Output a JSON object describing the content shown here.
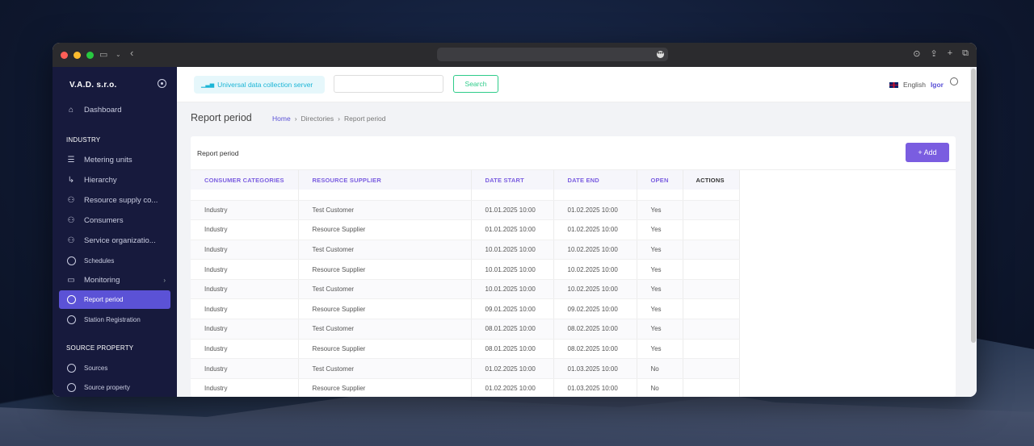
{
  "colors": {
    "accent": "#5b52d6",
    "add_button": "#7a5de0",
    "search_green": "#2ecc8a",
    "server_cyan": "#1bb5d6",
    "sidebar_bg": "#171a3d"
  },
  "sidebar": {
    "brand": "V.A.D. s.r.o.",
    "dashboard": "Dashboard",
    "section_industry": "INDUSTRY",
    "items": [
      {
        "label": "Metering units",
        "icon": "server-icon"
      },
      {
        "label": "Hierarchy",
        "icon": "arrow-turn-icon"
      },
      {
        "label": "Resource supply co...",
        "icon": "users-icon"
      },
      {
        "label": "Consumers",
        "icon": "users-icon"
      },
      {
        "label": "Service organizatio...",
        "icon": "users-icon"
      },
      {
        "label": "Schedules",
        "icon": "circle-icon"
      },
      {
        "label": "Monitoring",
        "icon": "monitor-icon"
      },
      {
        "label": "Report period",
        "icon": "circle-icon"
      },
      {
        "label": "Station Registration",
        "icon": "circle-icon"
      }
    ],
    "section_source": "SOURCE PROPERTY",
    "source_items": [
      {
        "label": "Sources",
        "icon": "circle-icon"
      },
      {
        "label": "Source property",
        "icon": "circle-icon"
      }
    ]
  },
  "header": {
    "server_label": "Universal data collection server",
    "search_value": "",
    "search_button": "Search",
    "language": "English",
    "user": "Igor"
  },
  "page": {
    "title": "Report period",
    "breadcrumb": [
      "Home",
      "Directories",
      "Report period"
    ]
  },
  "card": {
    "title": "Report period",
    "add_button": "+ Add"
  },
  "table": {
    "columns": [
      "CONSUMER CATEGORIES",
      "RESOURCE SUPPLIER",
      "DATE START",
      "DATE END",
      "OPEN",
      "ACTIONS"
    ],
    "rows": [
      [
        "Industry",
        "Test Customer",
        "01.01.2025 10:00",
        "01.02.2025 10:00",
        "Yes",
        ""
      ],
      [
        "Industry",
        "Resource Supplier",
        "01.01.2025 10:00",
        "01.02.2025 10:00",
        "Yes",
        ""
      ],
      [
        "Industry",
        "Test Customer",
        "10.01.2025 10:00",
        "10.02.2025 10:00",
        "Yes",
        ""
      ],
      [
        "Industry",
        "Resource Supplier",
        "10.01.2025 10:00",
        "10.02.2025 10:00",
        "Yes",
        ""
      ],
      [
        "Industry",
        "Test Customer",
        "10.01.2025 10:00",
        "10.02.2025 10:00",
        "Yes",
        ""
      ],
      [
        "Industry",
        "Resource Supplier",
        "09.01.2025 10:00",
        "09.02.2025 10:00",
        "Yes",
        ""
      ],
      [
        "Industry",
        "Test Customer",
        "08.01.2025 10:00",
        "08.02.2025 10:00",
        "Yes",
        ""
      ],
      [
        "Industry",
        "Resource Supplier",
        "08.01.2025 10:00",
        "08.02.2025 10:00",
        "Yes",
        ""
      ],
      [
        "Industry",
        "Test Customer",
        "01.02.2025 10:00",
        "01.03.2025 10:00",
        "No",
        ""
      ],
      [
        "Industry",
        "Resource Supplier",
        "01.02.2025 10:00",
        "01.03.2025 10:00",
        "No",
        ""
      ]
    ]
  }
}
